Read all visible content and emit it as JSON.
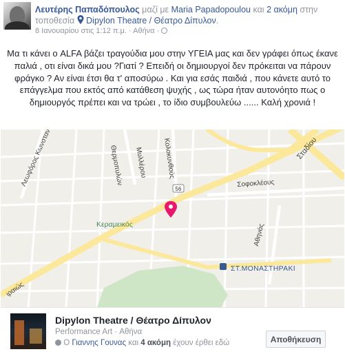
{
  "post": {
    "author": "Λευτέρης Παπαδόπουλος",
    "with_prefix": "μαζί με",
    "tagged_person": "Maria Papadopoulou",
    "and_text": "και",
    "others_link": "2 ακόμη",
    "location_prefix": "στην τοποθεσία",
    "location_name": "Dipylon Theatre / Θέατρο Δίπυλον",
    "location_suffix": ".",
    "date": "8 Ιανουαρίου στις 1:12 π.μ.",
    "separator": "·",
    "city": "Αθήνα",
    "privacy_dot": "·",
    "body": "Μα τι κάνει ο ALFA βάζει τραγούδια μου στην ΥΓΕΙΑ μας και δεν γράφει όπως έκανε παλιά , οτι είναι δικά μου ?Γιατί ? Επειδή οι δημιουργοί δεν πρόκειται να πάρουν φράγκο ? Αν είναι έτσι θα τ' αποσύρω . Και για εσάς παιδιά , που κάνετε αυτό το επάγγελμα που εκτός από κατάθεση ψυχής , ως τώρα ήταν αυτονόητο πως ο δημιουργός πρέπει και να τρώει , το ίδιο συμβουλεύω ...... Καλή χρονιά !"
  },
  "map": {
    "labels": {
      "konstantinoupoleos": "Λεωφόρος Κωνσταντιν",
      "thermopylon": "Θερμοπυλών",
      "millerou": "Μυλλέρου",
      "kolokynthous": "Κολοκυνθούς",
      "stadiou": "Σταδίου",
      "sofokleous": "Σοφοκλέους",
      "kerameikos": "Κεραμεικός",
      "athinas": "Αθηνάς",
      "monastiraki": "ΣΤ.ΜΟΝΑΣΤΗΡΑΚΙ",
      "peiraios": "ιραιώς",
      "route": "56"
    },
    "colors": {
      "background": "#f0efea",
      "major_road": "#fbe89a",
      "minor_road": "#ffffff",
      "park": "#cfe6c6",
      "pin": "#e8186d"
    }
  },
  "place": {
    "name": "Dipylon Theatre / Θέατρο Δίπυλον",
    "category": "Performance Art",
    "meta_sep": "·",
    "city": "Αθήνα",
    "friend_prefix": "Ο",
    "friend_name": "Γιαννης Γουνας",
    "friend_and": "και",
    "friend_others": "4 ακόμη",
    "friend_suffix": "έχουν έρθει εδώ",
    "save_label": "Αποθήκευση"
  }
}
